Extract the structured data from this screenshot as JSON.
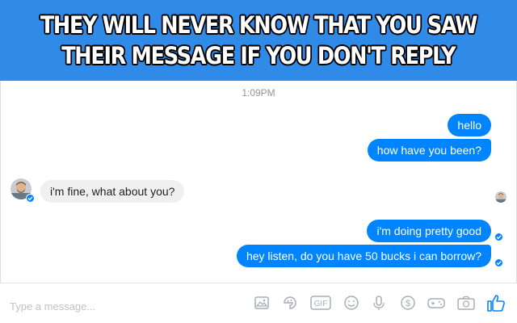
{
  "meme": {
    "line1": "THEY WILL NEVER KNOW THAT YOU SAW",
    "line2": "THEIR MESSAGE IF YOU DON'T REPLY"
  },
  "chat": {
    "timestamp": "1:09PM",
    "messages": [
      {
        "from": "me",
        "text": "hello"
      },
      {
        "from": "me",
        "text": "how have you been?"
      },
      {
        "from": "them",
        "text": "i'm fine, what about you?"
      },
      {
        "from": "me",
        "text": "i'm doing pretty good"
      },
      {
        "from": "me",
        "text": "hey listen, do you have 50 bucks i can borrow?"
      }
    ]
  },
  "composer": {
    "placeholder": "Type a message...",
    "icons": [
      "photo-icon",
      "sticker-icon",
      "gif-icon",
      "emoji-icon",
      "microphone-icon",
      "payment-icon",
      "game-controller-icon",
      "camera-icon",
      "like-icon"
    ],
    "gif_label": "GIF"
  },
  "colors": {
    "banner": "#2f8ae8",
    "outgoing_bubble": "#0084ff",
    "incoming_bubble": "#f1f0f0",
    "icon": "#a8aeb6",
    "like": "#0084ff"
  }
}
